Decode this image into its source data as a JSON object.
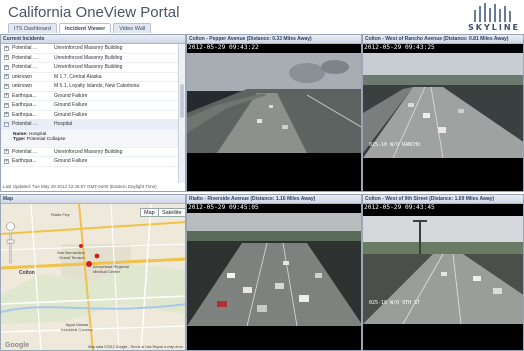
{
  "app": {
    "title": "California OneView Portal",
    "logo_text": "SKYLINE"
  },
  "tabs": [
    {
      "label": "ITS Dashboard",
      "active": false
    },
    {
      "label": "Incident Viewer",
      "active": true
    },
    {
      "label": "Video Wall",
      "active": false
    }
  ],
  "incidents": {
    "header": "Current Incidents",
    "rows": [
      {
        "type": "Potential ...",
        "desc": "Unreinforced Masonry Building"
      },
      {
        "type": "Potential ...",
        "desc": "Unreinforced Masonry Building"
      },
      {
        "type": "Potential ...",
        "desc": "Unreinforced Masonry Building"
      },
      {
        "type": "unknown",
        "desc": "M 1.7, Central Alaska"
      },
      {
        "type": "unknown",
        "desc": "M 5.1, Loyalty Islands, New Caledonia"
      },
      {
        "type": "Earthqua...",
        "desc": "Ground Failure"
      },
      {
        "type": "Earthqua...",
        "desc": "Ground Failure"
      },
      {
        "type": "Earthqua...",
        "desc": "Ground Failure"
      },
      {
        "type": "Potential ...",
        "desc": "Hospital"
      }
    ],
    "detail": {
      "name_label": "Name:",
      "name_value": "Hospital",
      "type_label": "Type:",
      "type_value": "Potential Collapse"
    },
    "rows_after": [
      {
        "type": "Potential ...",
        "desc": "Unreinforced Masonry Building"
      },
      {
        "type": "Earthqua...",
        "desc": "Ground Failure"
      }
    ],
    "last_updated": "Last Updated: Tue May 29 2012 12:45:07 GMT-0400 (Eastern Daylight Time)"
  },
  "map": {
    "header": "Map",
    "map_button": "Map",
    "satellite_button": "Satellite",
    "labels": {
      "l1": "Rialto Fwy",
      "l2": "Colton",
      "l3": "San Bernardino",
      "l4": "Grand Terrace",
      "l5": "Arrowhead Regional Medical Center",
      "l6": "Agua Mansa Industrial Corridor"
    },
    "attribution": "Map data ©2012 Google - Terms of Use  Report a map error",
    "google": "Google"
  },
  "cameras": [
    {
      "title": "Colton - Pepper Avenue (Distance: 0.33 Miles Away)",
      "timestamp": "2012-05-29 09:43:22",
      "caption": ""
    },
    {
      "title": "Colton - West of Rancho Avenue (Distance: 0.81 Miles Away)",
      "timestamp": "2012-05-29 09:43:25",
      "caption": "025-10 W/O RANCHO"
    },
    {
      "title": "Rialto - Riverside Avenue (Distance: 1.16 Miles Away)",
      "timestamp": "2012-05-29 09:45:05",
      "caption": ""
    },
    {
      "title": "Colton - West of 9th Street (Distance: 1.69 Miles Away)",
      "timestamp": "2012-05-29 09:43:45",
      "caption": "025-10 W/O 9TH ST"
    }
  ]
}
